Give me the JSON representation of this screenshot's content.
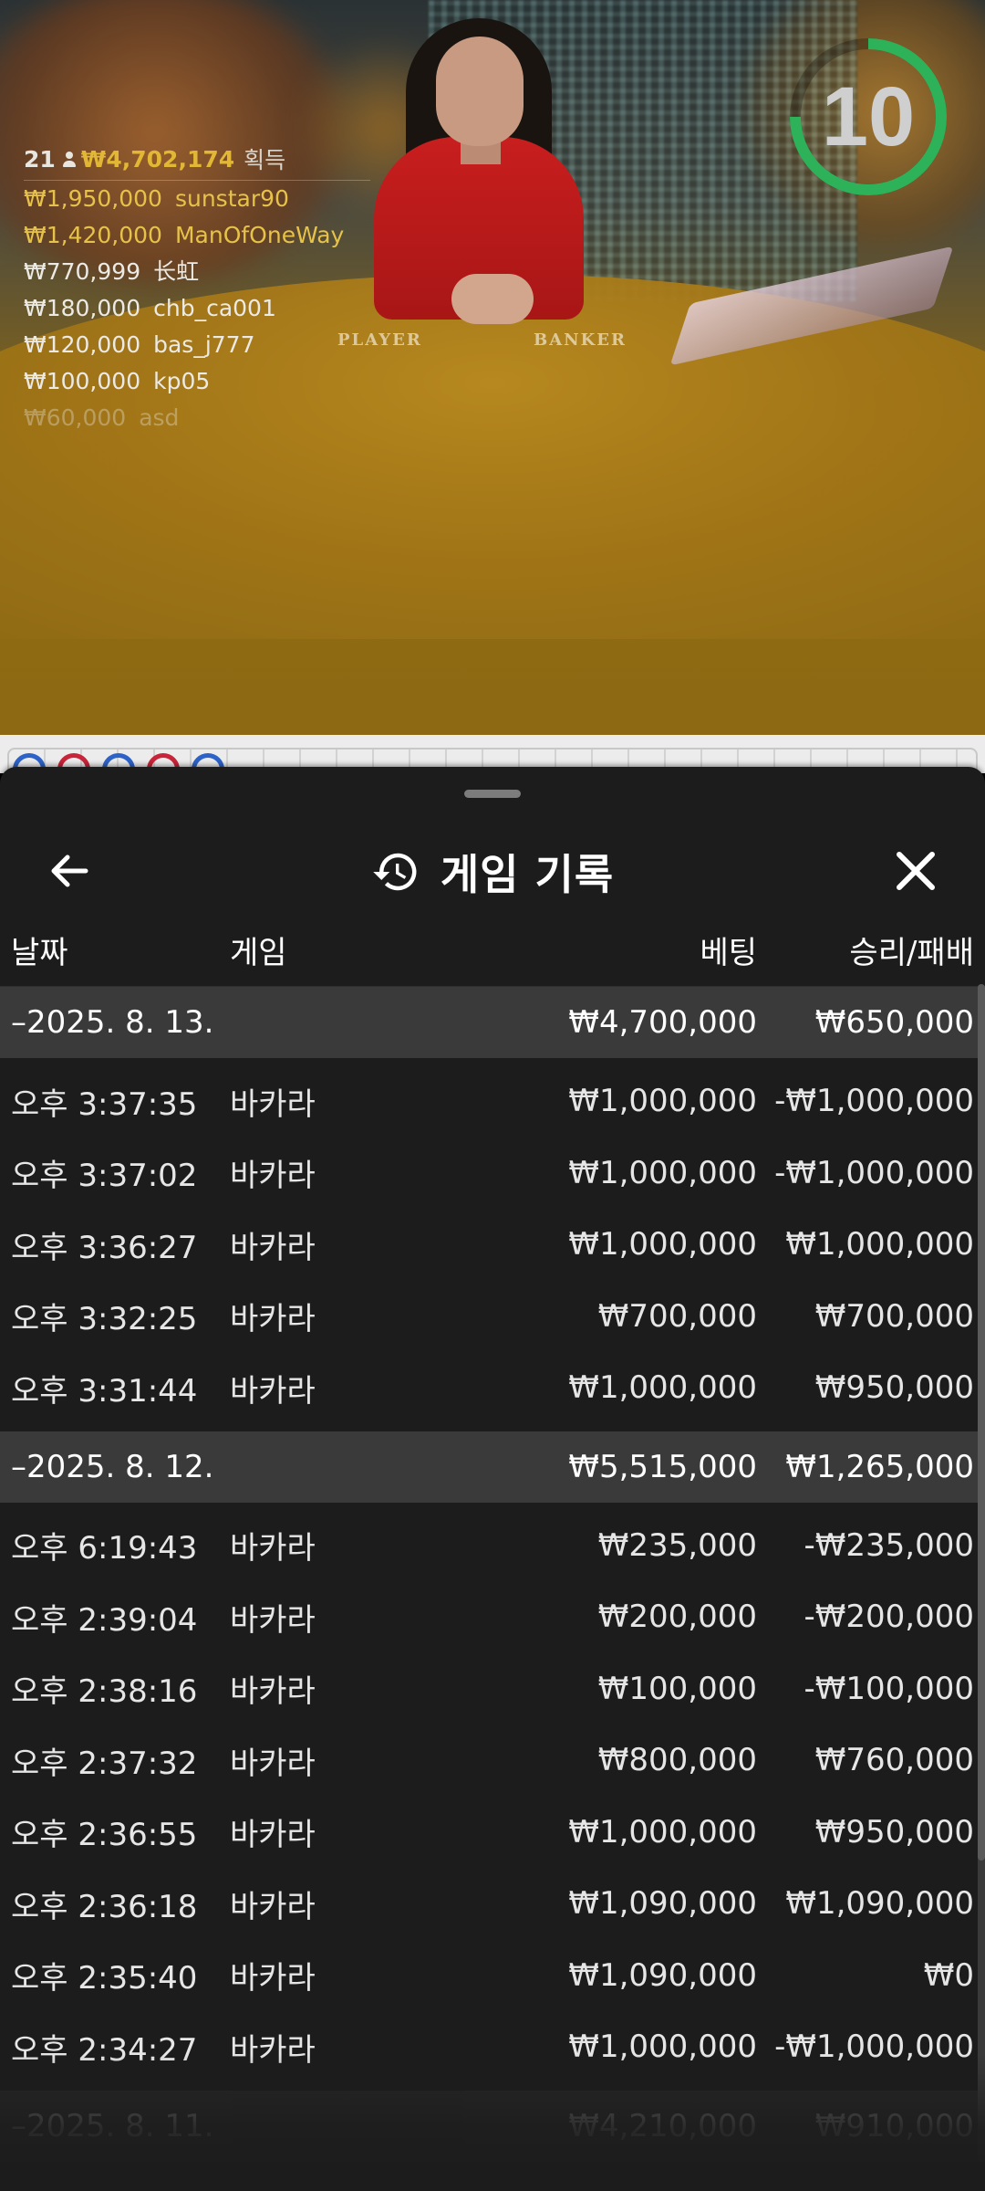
{
  "video": {
    "table_labels": [
      "PLAYER",
      "BANKER"
    ],
    "timer": {
      "value": "10",
      "progress": 0.75,
      "color": "#2db25a"
    }
  },
  "leaderboard": {
    "player_count": "21",
    "total": "₩4,702,174",
    "total_suffix": "획득",
    "rows": [
      {
        "amount": "₩1,950,000",
        "name": "sunstar90"
      },
      {
        "amount": "₩1,420,000",
        "name": "ManOfOneWay"
      },
      {
        "amount": "₩770,999",
        "name": "长虹"
      },
      {
        "amount": "₩180,000",
        "name": "chb_ca001"
      },
      {
        "amount": "₩120,000",
        "name": "bas_j777"
      },
      {
        "amount": "₩100,000",
        "name": "kp05"
      },
      {
        "amount": "₩60,000",
        "name": "asd"
      }
    ]
  },
  "bead_road": [
    "P",
    "B",
    "P",
    "B",
    "P"
  ],
  "colors": {
    "player": "#2d63c8",
    "banker": "#c8243a",
    "sheet_bg": "#1c1c1c",
    "group_bg": "#3a3a3a"
  },
  "sheet": {
    "title": "게임 기록",
    "icons": {
      "back": "arrow-left-icon",
      "history": "history-icon",
      "close": "close-icon"
    },
    "columns": {
      "date": "날짜",
      "game": "게임",
      "bet": "베팅",
      "result": "승리/패배"
    },
    "groups": [
      {
        "date": "–2025. 8. 13.",
        "bet": "₩4,700,000",
        "result": "₩650,000",
        "rows": [
          {
            "time": "오후 3:37:35",
            "game": "바카라",
            "bet": "₩1,000,000",
            "result": "-₩1,000,000"
          },
          {
            "time": "오후 3:37:02",
            "game": "바카라",
            "bet": "₩1,000,000",
            "result": "-₩1,000,000"
          },
          {
            "time": "오후 3:36:27",
            "game": "바카라",
            "bet": "₩1,000,000",
            "result": "₩1,000,000"
          },
          {
            "time": "오후 3:32:25",
            "game": "바카라",
            "bet": "₩700,000",
            "result": "₩700,000"
          },
          {
            "time": "오후 3:31:44",
            "game": "바카라",
            "bet": "₩1,000,000",
            "result": "₩950,000"
          }
        ]
      },
      {
        "date": "–2025. 8. 12.",
        "bet": "₩5,515,000",
        "result": "₩1,265,000",
        "rows": [
          {
            "time": "오후 6:19:43",
            "game": "바카라",
            "bet": "₩235,000",
            "result": "-₩235,000"
          },
          {
            "time": "오후 2:39:04",
            "game": "바카라",
            "bet": "₩200,000",
            "result": "-₩200,000"
          },
          {
            "time": "오후 2:38:16",
            "game": "바카라",
            "bet": "₩100,000",
            "result": "-₩100,000"
          },
          {
            "time": "오후 2:37:32",
            "game": "바카라",
            "bet": "₩800,000",
            "result": "₩760,000"
          },
          {
            "time": "오후 2:36:55",
            "game": "바카라",
            "bet": "₩1,000,000",
            "result": "₩950,000"
          },
          {
            "time": "오후 2:36:18",
            "game": "바카라",
            "bet": "₩1,090,000",
            "result": "₩1,090,000"
          },
          {
            "time": "오후 2:35:40",
            "game": "바카라",
            "bet": "₩1,090,000",
            "result": "₩0"
          },
          {
            "time": "오후 2:34:27",
            "game": "바카라",
            "bet": "₩1,000,000",
            "result": "-₩1,000,000"
          }
        ]
      },
      {
        "date": "–2025. 8. 11.",
        "bet": "₩4,210,000",
        "result": "₩910,000",
        "rows": []
      }
    ]
  }
}
